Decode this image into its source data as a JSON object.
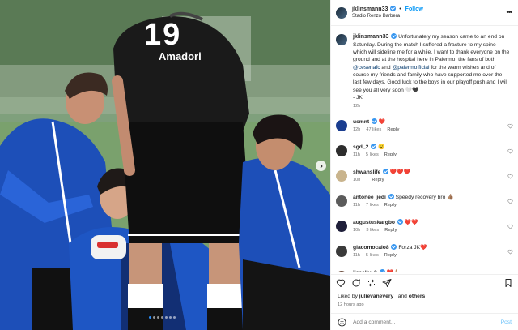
{
  "post": {
    "username": "jklinsmann33",
    "follow_label": "Follow",
    "dot_separator": "•",
    "location": "Stadio Renzo Barbera",
    "more_label": "•••",
    "caption": {
      "part1": "Unfortunately my season came to an end on Saturday. During the match I suffered a fracture to my spine which will sideline me for a while. I want to thank everyone on the ground and at the hospital here in Palermo, the fans of both ",
      "mention1": "@cesenafc",
      "and": " and ",
      "mention2": "@palermofficial",
      "part2": " for the warm wishes and of course my friends and family who have supported me over the last few days. Good luck to the boys in our playoff push and I will see you all very soon ",
      "hearts": "🤍🖤",
      "sign": "- JK",
      "time": "12h"
    },
    "photo": {
      "jersey_number": "19",
      "jersey_text": "Amadori"
    }
  },
  "comments": [
    {
      "user": "usmnt",
      "text": "❤️",
      "time": "12h",
      "likes": "47 likes",
      "reply": "Reply",
      "color": "#1a3d8f"
    },
    {
      "user": "sgd_2",
      "text": "😮",
      "time": "11h",
      "likes": "5 likes",
      "reply": "Reply",
      "color": "#2d2d2d"
    },
    {
      "user": "shwanslife",
      "text": "❤️❤️❤️",
      "time": "10h",
      "likes": "",
      "reply": "Reply",
      "color": "#c9b48d"
    },
    {
      "user": "antonee_jedi",
      "text": "Speedy recovery bro 👍🏽",
      "time": "11h",
      "likes": "7 likes",
      "reply": "Reply",
      "color": "#5b5b5b"
    },
    {
      "user": "augustuskargbo",
      "text": "❤️❤️",
      "time": "10h",
      "likes": "3 likes",
      "reply": "Reply",
      "color": "#1f1f3a"
    },
    {
      "user": "giacomocalo8",
      "text": "Forza JK❤️",
      "time": "11h",
      "likes": "5 likes",
      "reply": "Reply",
      "color": "#3a3a3a"
    },
    {
      "user": "jjscally_3",
      "text": "❤️🙏🏼",
      "time": "",
      "likes": "",
      "reply": "",
      "color": "#6b4c3b"
    }
  ],
  "footer": {
    "liked_by_prefix": "Liked by ",
    "liked_by_user": "julievanevery_",
    "liked_by_and": " and ",
    "liked_by_others": "others",
    "time_ago": "12 hours ago",
    "add_comment_placeholder": "Add a comment...",
    "post_label": "Post"
  },
  "icons": {
    "like": "heart-icon",
    "comment": "comment-icon",
    "share": "share-icon",
    "save": "bookmark-icon",
    "emoji": "emoji-icon",
    "next": "chevron-right-icon"
  },
  "colors": {
    "accent": "#0095f6",
    "verified": "#3897f0",
    "heart": "#e0245e",
    "kit_blue": "#1d4fb8"
  }
}
